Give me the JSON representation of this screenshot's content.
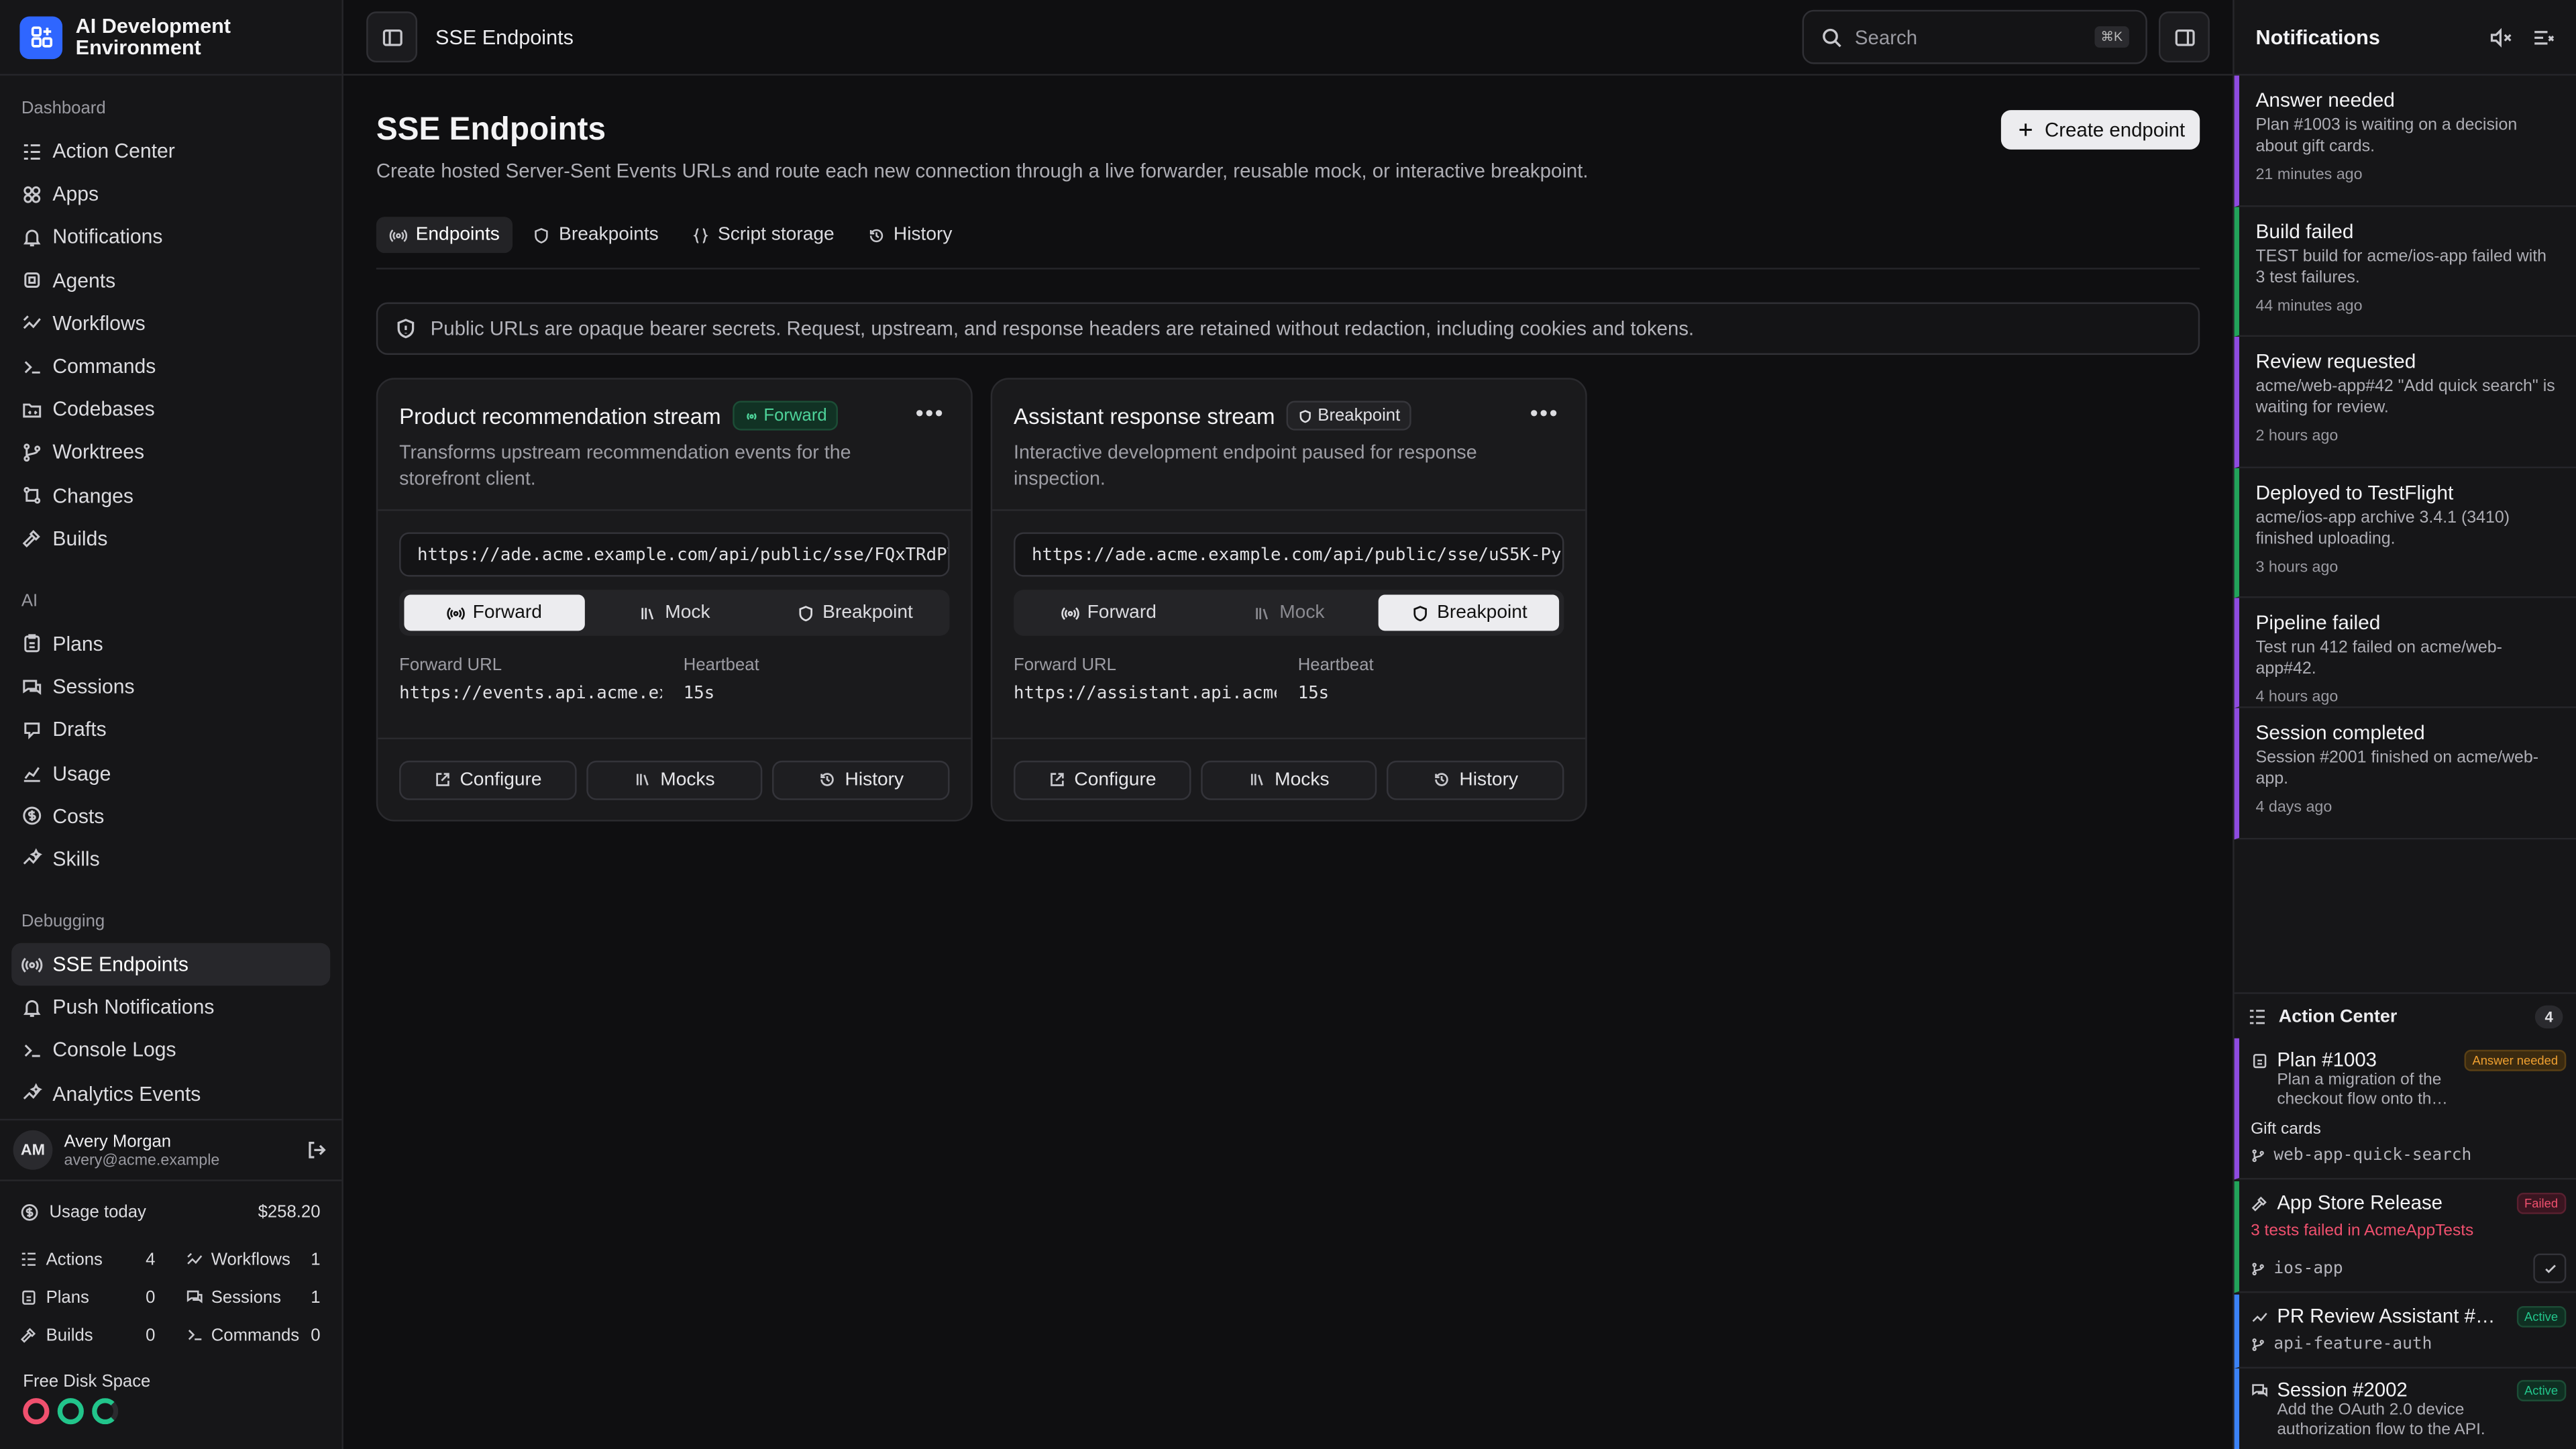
{
  "app": {
    "title": "AI Development Environment"
  },
  "sidebar": {
    "sections": [
      {
        "label": "Dashboard",
        "items": [
          {
            "label": "Action Center",
            "icon": "list-checks-icon"
          },
          {
            "label": "Apps",
            "icon": "apps-icon"
          },
          {
            "label": "Notifications",
            "icon": "bell-icon"
          },
          {
            "label": "Agents",
            "icon": "cpu-icon"
          },
          {
            "label": "Workflows",
            "icon": "workflow-icon"
          },
          {
            "label": "Commands",
            "icon": "terminal-icon"
          },
          {
            "label": "Codebases",
            "icon": "folder-code-icon"
          },
          {
            "label": "Worktrees",
            "icon": "git-branch-icon"
          },
          {
            "label": "Changes",
            "icon": "git-compare-icon"
          },
          {
            "label": "Builds",
            "icon": "hammer-icon"
          }
        ]
      },
      {
        "label": "AI",
        "items": [
          {
            "label": "Plans",
            "icon": "clipboard-icon"
          },
          {
            "label": "Sessions",
            "icon": "chat-icon"
          },
          {
            "label": "Drafts",
            "icon": "drafts-icon"
          },
          {
            "label": "Usage",
            "icon": "chart-icon"
          },
          {
            "label": "Costs",
            "icon": "dollar-icon"
          },
          {
            "label": "Skills",
            "icon": "sparkles-icon"
          }
        ]
      },
      {
        "label": "Debugging",
        "items": [
          {
            "label": "SSE Endpoints",
            "icon": "radio-icon",
            "active": true
          },
          {
            "label": "Push Notifications",
            "icon": "bell-ring-icon"
          },
          {
            "label": "Console Logs",
            "icon": "terminal-icon"
          },
          {
            "label": "Analytics Events",
            "icon": "sparkles-icon"
          }
        ]
      }
    ],
    "user": {
      "initials": "AM",
      "name": "Avery Morgan",
      "email": "avery@acme.example"
    },
    "usage": {
      "label": "Usage today",
      "amount": "$258.20",
      "stats": [
        {
          "label": "Actions",
          "value": "4"
        },
        {
          "label": "Workflows",
          "value": "1"
        },
        {
          "label": "Plans",
          "value": "0"
        },
        {
          "label": "Sessions",
          "value": "1"
        },
        {
          "label": "Builds",
          "value": "0"
        },
        {
          "label": "Commands",
          "value": "0"
        }
      ]
    },
    "disk": {
      "label": "Free Disk Space",
      "colors": [
        "#f0506e",
        "#22c58b",
        "#22c58b"
      ]
    }
  },
  "topbar": {
    "title": "SSE Endpoints",
    "search_placeholder": "Search",
    "search_shortcut": "⌘K"
  },
  "main": {
    "title": "SSE Endpoints",
    "description": "Create hosted Server-Sent Events URLs and route each new connection through a live forwarder, reusable mock, or interactive breakpoint.",
    "create_label": "Create endpoint",
    "tabs": [
      {
        "label": "Endpoints",
        "active": true
      },
      {
        "label": "Breakpoints"
      },
      {
        "label": "Script storage"
      },
      {
        "label": "History"
      }
    ],
    "alert": "Public URLs are opaque bearer secrets. Request, upstream, and response headers are retained without redaction, including cookies and tokens.",
    "cards": [
      {
        "title": "Product recommendation stream",
        "badge": "Forward",
        "description": "Transforms upstream recommendation events for the storefront client.",
        "url": "https://ade.acme.example.com/api/public/sse/FQxTRdPV…",
        "modes": [
          "Forward",
          "Mock",
          "Breakpoint"
        ],
        "selected_mode": "Forward",
        "forward_label": "Forward URL",
        "forward_url": "https://events.api.acme.ex…",
        "heartbeat_label": "Heartbeat",
        "heartbeat": "15s",
        "actions": [
          "Configure",
          "Mocks",
          "History"
        ]
      },
      {
        "title": "Assistant response stream",
        "badge": "Breakpoint",
        "description": "Interactive development endpoint paused for response inspection.",
        "url": "https://ade.acme.example.com/api/public/sse/uS5K-Pyg…",
        "modes": [
          "Forward",
          "Mock",
          "Breakpoint"
        ],
        "selected_mode": "Breakpoint",
        "forward_label": "Forward URL",
        "forward_url": "https://assistant.api.acme…",
        "heartbeat_label": "Heartbeat",
        "heartbeat": "15s",
        "actions": [
          "Configure",
          "Mocks",
          "History"
        ]
      }
    ]
  },
  "notifications": {
    "title": "Notifications",
    "items": [
      {
        "title": "Answer needed",
        "body": "Plan #1003 is waiting on a decision about gift cards.",
        "time": "21 minutes ago",
        "color": "#8e4be0"
      },
      {
        "title": "Build failed",
        "body": "TEST build for acme/ios-app failed with 3 test failures.",
        "time": "44 minutes ago",
        "color": "#22a35a"
      },
      {
        "title": "Review requested",
        "body": "acme/web-app#42 \"Add quick search\" is waiting for review.",
        "time": "2 hours ago",
        "color": "#8e4be0"
      },
      {
        "title": "Deployed to TestFlight",
        "body": "acme/ios-app archive 3.4.1 (3410) finished uploading.",
        "time": "3 hours ago",
        "color": "#22a35a"
      },
      {
        "title": "Pipeline failed",
        "body": "Test run 412 failed on acme/web-app#42.",
        "time": "4 hours ago",
        "color": "#8e4be0"
      },
      {
        "title": "Session completed",
        "body": "Session #2001 finished on acme/web-app.",
        "time": "4 days ago",
        "color": "#8e4be0"
      }
    ],
    "action_center": {
      "title": "Action Center",
      "count": "4",
      "items": [
        {
          "title": "Plan #1003",
          "badge": "Answer needed",
          "badge_color": "#f0a030",
          "desc": "Plan a migration of the checkout flow onto th…",
          "extra": "Gift cards",
          "branch": "web-app-quick-search",
          "color": "#8e4be0"
        },
        {
          "title": "App Store Release",
          "badge": "Failed",
          "badge_color": "#f0506e",
          "desc": "3 tests failed in AcmeAppTests",
          "branch": "ios-app",
          "color": "#22a35a"
        },
        {
          "title": "PR Review Assistant #4…",
          "badge": "Active",
          "badge_color": "#22c58b",
          "branch": "api-feature-auth",
          "color": "#3b82f6"
        },
        {
          "title": "Session #2002",
          "badge": "Active",
          "badge_color": "#22c58b",
          "desc": "Add the OAuth 2.0 device authorization flow to the API.",
          "color": "#3b82f6"
        }
      ]
    }
  }
}
